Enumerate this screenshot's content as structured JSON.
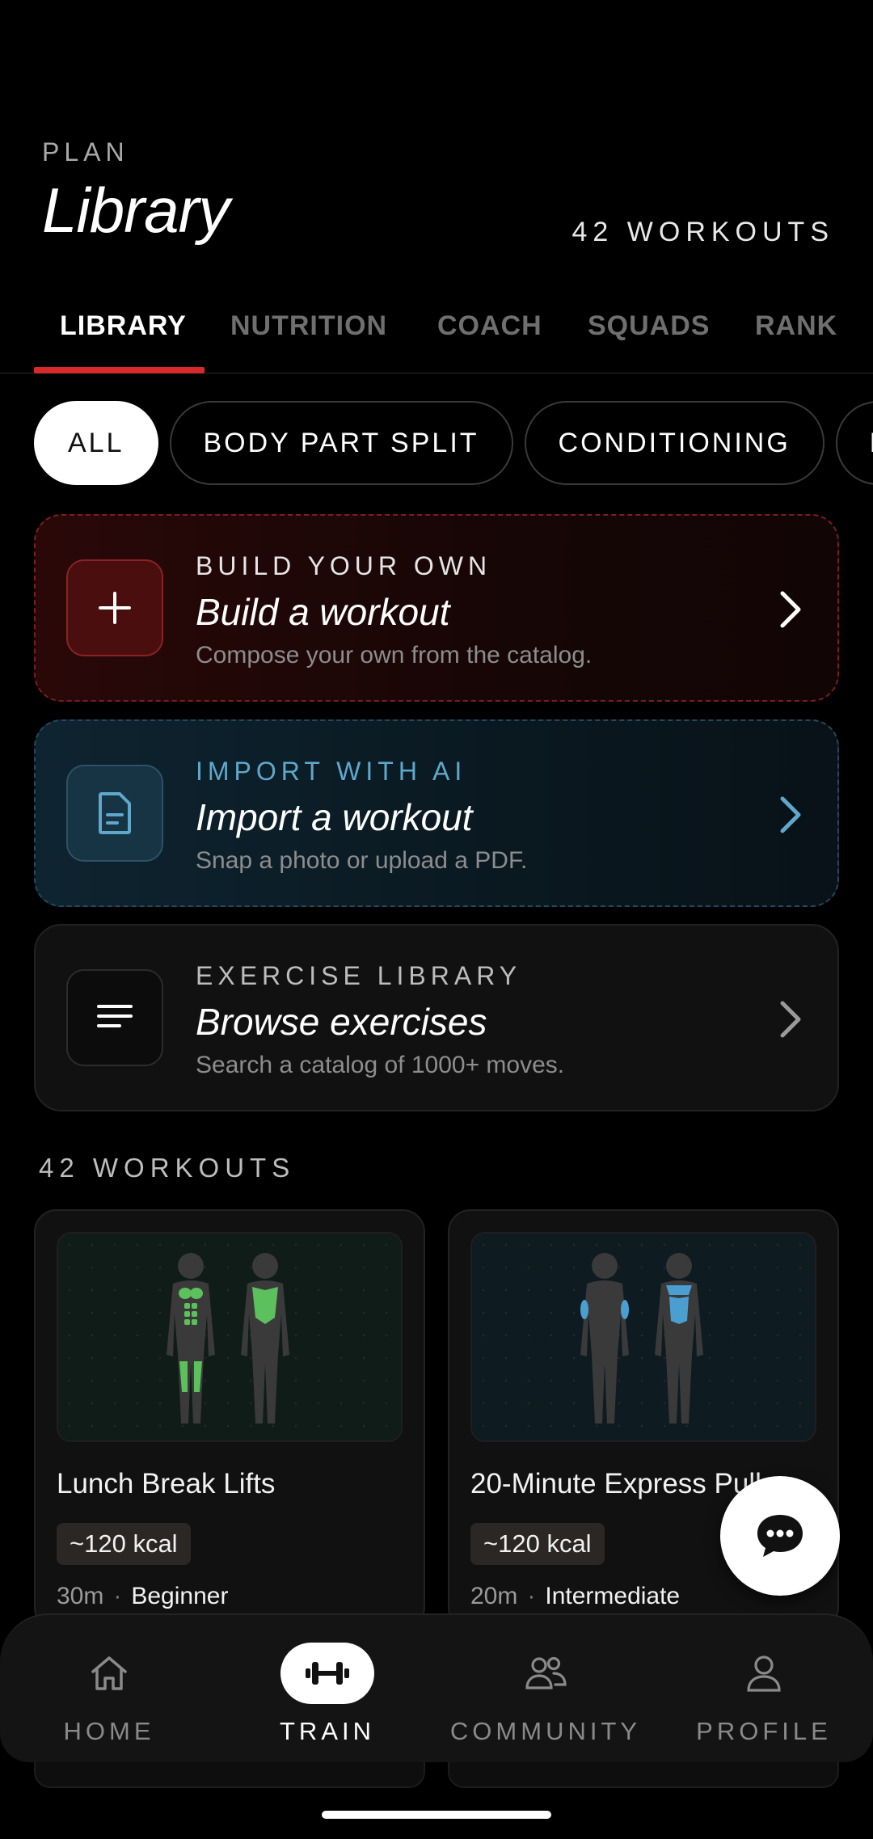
{
  "header": {
    "eyebrow": "PLAN",
    "title": "Library",
    "workout_count": "42 WORKOUTS"
  },
  "tabs": [
    {
      "label": "LIBRARY",
      "active": true
    },
    {
      "label": "NUTRITION",
      "active": false
    },
    {
      "label": "COACH",
      "active": false
    },
    {
      "label": "SQUADS",
      "active": false
    },
    {
      "label": "RANK",
      "active": false
    }
  ],
  "filters": [
    {
      "label": "ALL",
      "active": true
    },
    {
      "label": "BODY PART SPLIT",
      "active": false
    },
    {
      "label": "CONDITIONING",
      "active": false
    },
    {
      "label": "FUL",
      "active": false
    }
  ],
  "actions": {
    "build": {
      "kicker": "BUILD YOUR OWN",
      "title": "Build a workout",
      "subtitle": "Compose your own from the catalog.",
      "icon": "plus-icon",
      "accent": "#d72b2b"
    },
    "import": {
      "kicker": "IMPORT WITH AI",
      "title": "Import a workout",
      "subtitle": "Snap a photo or upload a PDF.",
      "icon": "document-icon",
      "accent": "#5fa8cc"
    },
    "exercise": {
      "kicker": "EXERCISE LIBRARY",
      "title": "Browse exercises",
      "subtitle": "Search a catalog of 1000+ moves.",
      "icon": "list-icon",
      "accent": "#bdbdbd"
    }
  },
  "section_label": "42 WORKOUTS",
  "workouts": [
    {
      "title": "Lunch Break Lifts",
      "kcal": "~120 kcal",
      "duration": "30m",
      "level": "Beginner",
      "highlight": "#5cc05c"
    },
    {
      "title": "20-Minute Express Pull",
      "kcal": "~120 kcal",
      "duration": "20m",
      "level": "Intermediate",
      "highlight": "#4a9fd0"
    }
  ],
  "bottom_nav": [
    {
      "label": "HOME",
      "icon": "home-icon",
      "active": false
    },
    {
      "label": "TRAIN",
      "icon": "dumbbell-icon",
      "active": true
    },
    {
      "label": "COMMUNITY",
      "icon": "community-icon",
      "active": false
    },
    {
      "label": "PROFILE",
      "icon": "person-icon",
      "active": false
    }
  ],
  "fab": {
    "icon": "chat-icon"
  }
}
